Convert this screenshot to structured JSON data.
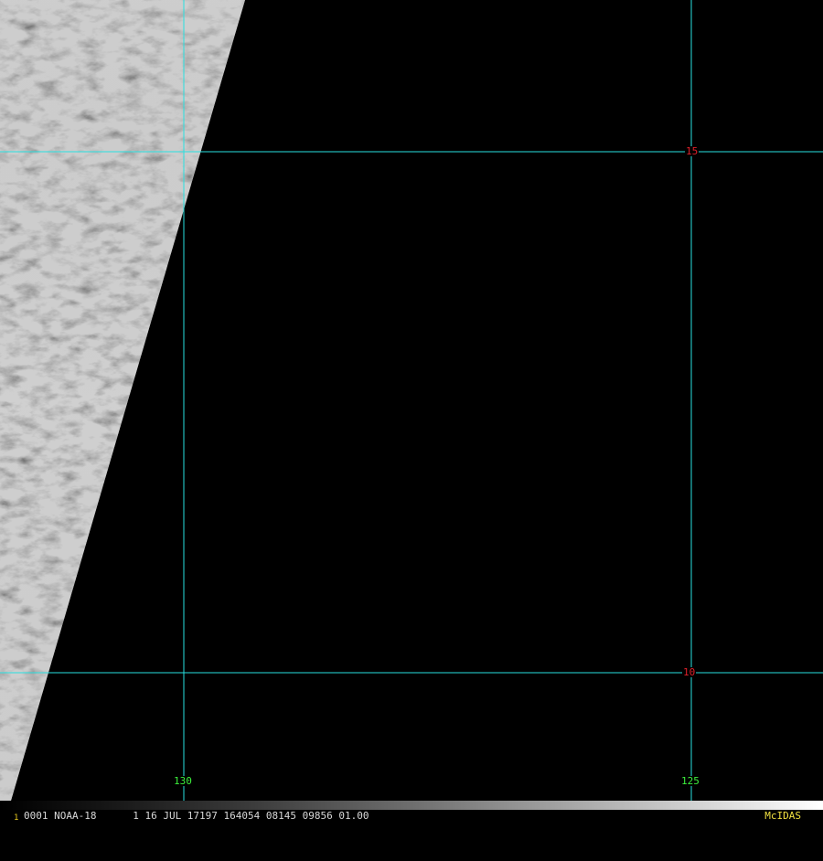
{
  "grid": {
    "color": "#29e0e0",
    "latitudes": [
      {
        "value": 15,
        "label": "15"
      },
      {
        "value": 10,
        "label": "10"
      }
    ],
    "longitudes": [
      {
        "value": 130,
        "label": "130"
      },
      {
        "value": 125,
        "label": "125"
      }
    ],
    "lat_label_color": "#e0202a",
    "lon_label_color": "#3cf03c"
  },
  "footer": {
    "frame_number": "1",
    "info": "0001 NOAA-18      1 16 JUL 17197 164054 08145 09856 01.00",
    "brand": "McIDAS"
  }
}
